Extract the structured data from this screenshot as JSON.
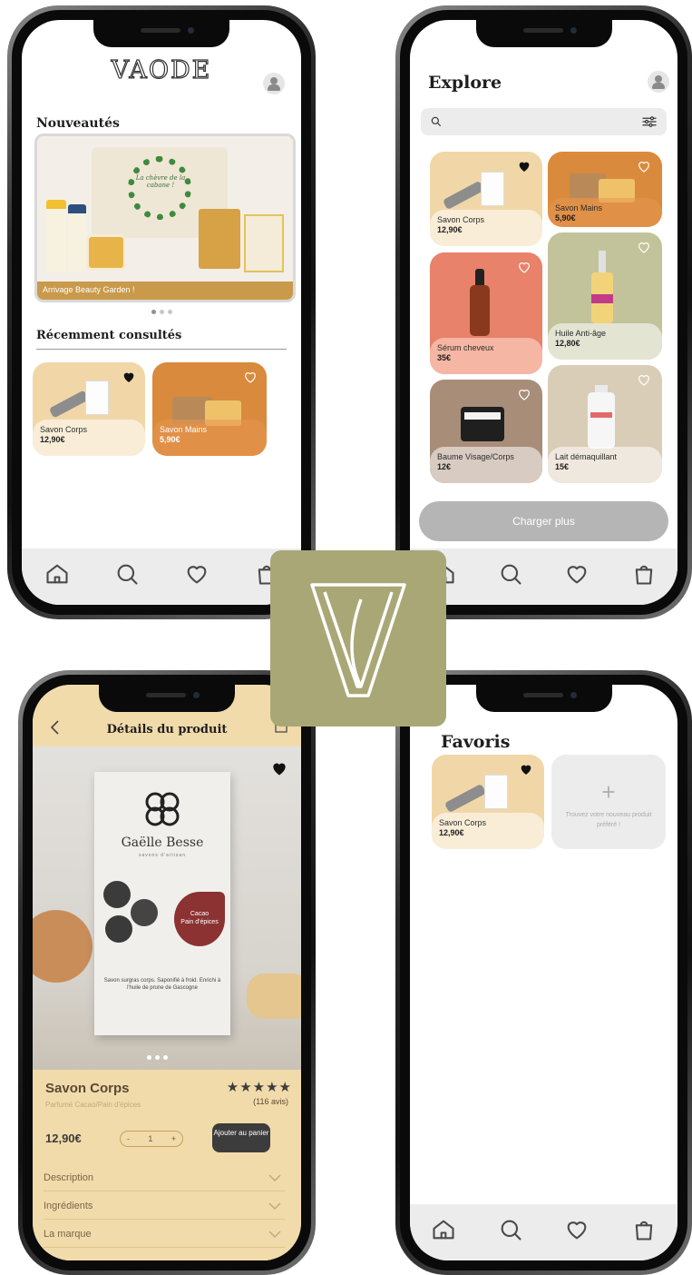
{
  "home": {
    "logo": "VAODE",
    "new_title": "Nouveautés",
    "banner_caption": "Arrivage Beauty Garden !",
    "banner_pouch_text": "La chèvre de la cabane !",
    "recent_title": "Récemment consultés",
    "recent_products": [
      {
        "name": "Savon Corps",
        "price": "12,90€",
        "favorited": true
      },
      {
        "name": "Savon Mains",
        "price": "5,90€",
        "favorited": false
      }
    ]
  },
  "explore": {
    "title": "Explore",
    "search_placeholder": "",
    "products": [
      {
        "name": "Savon Corps",
        "price": "12,90€",
        "favorited": true
      },
      {
        "name": "Savon Mains",
        "price": "5,90€",
        "favorited": false
      },
      {
        "name": "Sérum cheveux",
        "price": "35€",
        "favorited": false
      },
      {
        "name": "Huile Anti-âge",
        "price": "12,80€",
        "favorited": false
      },
      {
        "name": "Baume Visage/Corps",
        "price": "12€",
        "favorited": false
      },
      {
        "name": "Lait démaquillant",
        "price": "15€",
        "favorited": false
      }
    ],
    "load_more": "Charger plus"
  },
  "details": {
    "title": "Détails du produit",
    "brand_name": "Gaëlle Besse",
    "brand_sub": "savons d'artisan",
    "box_flavor_1": "Cacao",
    "box_flavor_2": "Pain d'épices",
    "box_text": "Savon surgras corps. Saponifié à froid. Enrichi à l'huile de prune de Gascogne",
    "product_name": "Savon Corps",
    "product_subtitle": "Parfumé Cacao/Pain d'épices",
    "rating": 5,
    "reviews": "(116 avis)",
    "price": "12,90€",
    "quantity": "1",
    "qty_minus": "-",
    "qty_plus": "+",
    "add_to_cart": "Ajouter au panier",
    "accordion": [
      "Description",
      "Ingrédients",
      "La marque"
    ]
  },
  "favorites": {
    "title": "Favoris",
    "items": [
      {
        "name": "Savon Corps",
        "price": "12,90€",
        "favorited": true
      }
    ],
    "add_hint": "Trouvez votre nouveau produit préféré !"
  },
  "colors": {
    "accent_olive": "#a9a776",
    "sand": "#f1dbaa",
    "orange": "#d98a3d",
    "terracotta": "#e8826a",
    "sage": "#c2c39b",
    "taupe": "#a88d79",
    "beige": "#d9cdb7"
  },
  "icons": [
    "home-icon",
    "search-icon",
    "heart-icon",
    "bag-icon",
    "user-icon",
    "filter-icon",
    "back-icon",
    "share-icon",
    "plus-icon",
    "chevron-down-icon"
  ]
}
